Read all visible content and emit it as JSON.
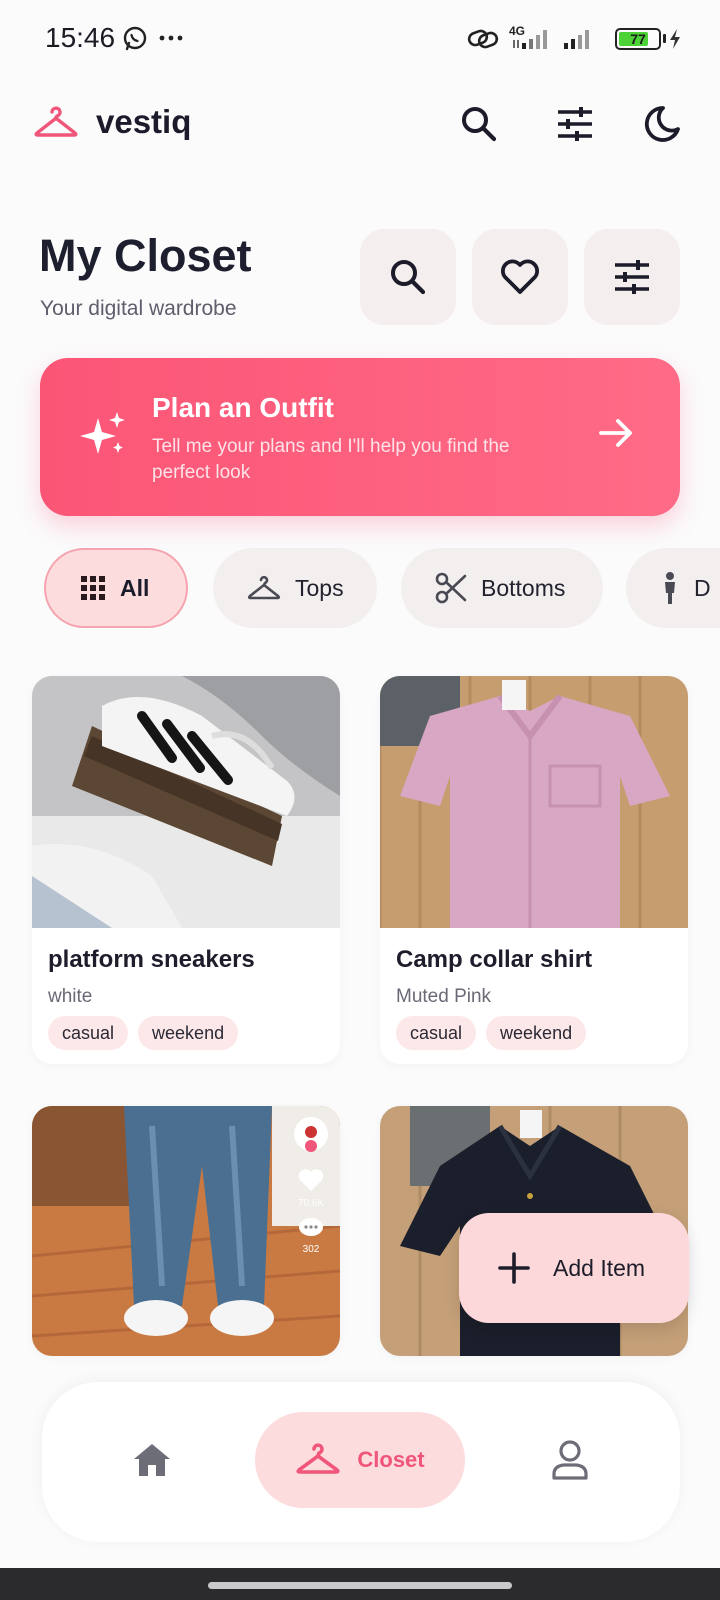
{
  "status_bar": {
    "time": "15:46",
    "network": "4G",
    "battery": "77",
    "battery_level": 0.77
  },
  "app": {
    "name": "vestiq",
    "accent": "#f0557a"
  },
  "header": {
    "title": "My Closet",
    "subtitle": "Your digital wardrobe"
  },
  "plan": {
    "title": "Plan an Outfit",
    "subtitle": "Tell me your plans and I'll help you find the perfect look"
  },
  "filters": [
    {
      "label": "All",
      "icon": "grid-icon",
      "selected": true
    },
    {
      "label": "Tops",
      "icon": "hanger-icon",
      "selected": false
    },
    {
      "label": "Bottoms",
      "icon": "scissors-icon",
      "selected": false
    },
    {
      "label": "D",
      "icon": "person-icon",
      "selected": false
    }
  ],
  "items": [
    {
      "name": "platform sneakers",
      "color": "white",
      "tags": [
        "casual",
        "weekend"
      ]
    },
    {
      "name": "Camp collar shirt",
      "color": "Muted Pink",
      "tags": [
        "casual",
        "weekend"
      ]
    },
    {
      "name": "",
      "color": "",
      "tags": []
    },
    {
      "name": "",
      "color": "",
      "tags": []
    }
  ],
  "photo_overlay": {
    "likes": "70.6K",
    "comments": "302"
  },
  "fab": {
    "label": "Add Item"
  },
  "nav": {
    "items": [
      {
        "label": "Home",
        "icon": "home-icon"
      },
      {
        "label": "Closet",
        "icon": "hanger-icon"
      },
      {
        "label": "Profile",
        "icon": "person-icon"
      }
    ],
    "active_label": "Closet"
  }
}
